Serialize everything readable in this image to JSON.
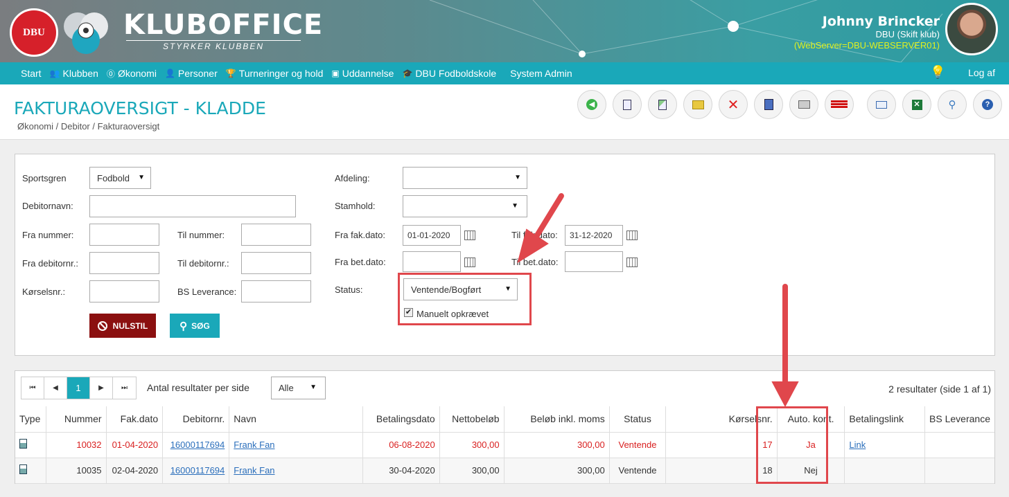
{
  "header": {
    "logo_text": "DBU",
    "brand": "KLUBOFFICE",
    "brand_sub": "STYRKER KLUBBEN",
    "user_name": "Johnny Brincker",
    "user_club": "DBU (Skift klub)",
    "user_server": "(WebServer=DBU-WEBSERVER01)"
  },
  "nav": {
    "items": [
      {
        "label": "Start",
        "icon": ""
      },
      {
        "label": "Klubben",
        "icon": "users-icon"
      },
      {
        "label": "Økonomi",
        "icon": "coin-icon"
      },
      {
        "label": "Personer",
        "icon": "person-icon"
      },
      {
        "label": "Turneringer og hold",
        "icon": "trophy-icon"
      },
      {
        "label": "Uddannelse",
        "icon": "monitor-icon"
      },
      {
        "label": "DBU Fodboldskole",
        "icon": "graduation-icon"
      },
      {
        "label": "System Admin",
        "icon": ""
      }
    ],
    "logout": "Log af"
  },
  "page": {
    "title": "FAKTURAOVERSIGT - KLADDE",
    "breadcrumb": "Økonomi / Debitor / Fakturaoversigt"
  },
  "toolbar": {
    "buttons": [
      "back-icon",
      "document-icon",
      "document-add-icon",
      "folder-open-icon",
      "delete-icon",
      "export-icon",
      "print-icon",
      "bs-logo-icon",
      "mail-icon",
      "excel-icon",
      "search-icon",
      "help-icon"
    ]
  },
  "filter": {
    "sportsgren_label": "Sportsgren",
    "sportsgren_value": "Fodbold",
    "debitornavn_label": "Debitornavn:",
    "fra_nummer_label": "Fra nummer:",
    "til_nummer_label": "Til nummer:",
    "fra_debitornr_label": "Fra debitornr.:",
    "til_debitornr_label": "Til debitornr.:",
    "korselsnr_label": "Kørselsnr.:",
    "bs_leverance_label": "BS Leverance:",
    "afdeling_label": "Afdeling:",
    "stamhold_label": "Stamhold:",
    "fra_fakdato_label": "Fra fak.dato:",
    "fra_fakdato_value": "01-01-2020",
    "til_fakdato_label": "Til fak.dato:",
    "til_fakdato_value": "31-12-2020",
    "fra_betdato_label": "Fra bet.dato:",
    "til_betdato_label": "Til bet.dato:",
    "status_label": "Status:",
    "status_value": "Ventende/Bogført",
    "manuelt_label": "Manuelt opkrævet",
    "manuelt_checked": true,
    "reset_label": "NULSTIL",
    "search_label": "SØG"
  },
  "results": {
    "per_page_label": "Antal resultater per side",
    "per_page_value": "Alle",
    "current_page": "1",
    "summary": "2 resultater (side 1 af 1)",
    "columns": [
      "Type",
      "Nummer",
      "Fak.dato",
      "Debitornr.",
      "Navn",
      "Betalingsdato",
      "Nettobeløb",
      "Beløb inkl. moms",
      "Status",
      "Kørselsnr.",
      "Auto. kont.",
      "Betalingslink",
      "BS Leverance"
    ],
    "rows": [
      {
        "nummer": "10032",
        "fakdato": "01-04-2020",
        "debitornr": "16000117694",
        "navn": "Frank Fan",
        "betalingsdato": "06-08-2020",
        "netto": "300,00",
        "inkl_moms": "300,00",
        "status": "Ventende",
        "korselsnr": "17",
        "auto_kont": "Ja",
        "betalingslink": "Link",
        "bs_leverance": ""
      },
      {
        "nummer": "10035",
        "fakdato": "02-04-2020",
        "debitornr": "16000117694",
        "navn": "Frank Fan",
        "betalingsdato": "30-04-2020",
        "netto": "300,00",
        "inkl_moms": "300,00",
        "status": "Ventende",
        "korselsnr": "18",
        "auto_kont": "Nej",
        "betalingslink": "",
        "bs_leverance": ""
      }
    ]
  },
  "colors": {
    "accent": "#1aa8b9",
    "highlight": "#e0474c",
    "reset_button": "#8b1010",
    "overdue_text": "#d92020"
  }
}
